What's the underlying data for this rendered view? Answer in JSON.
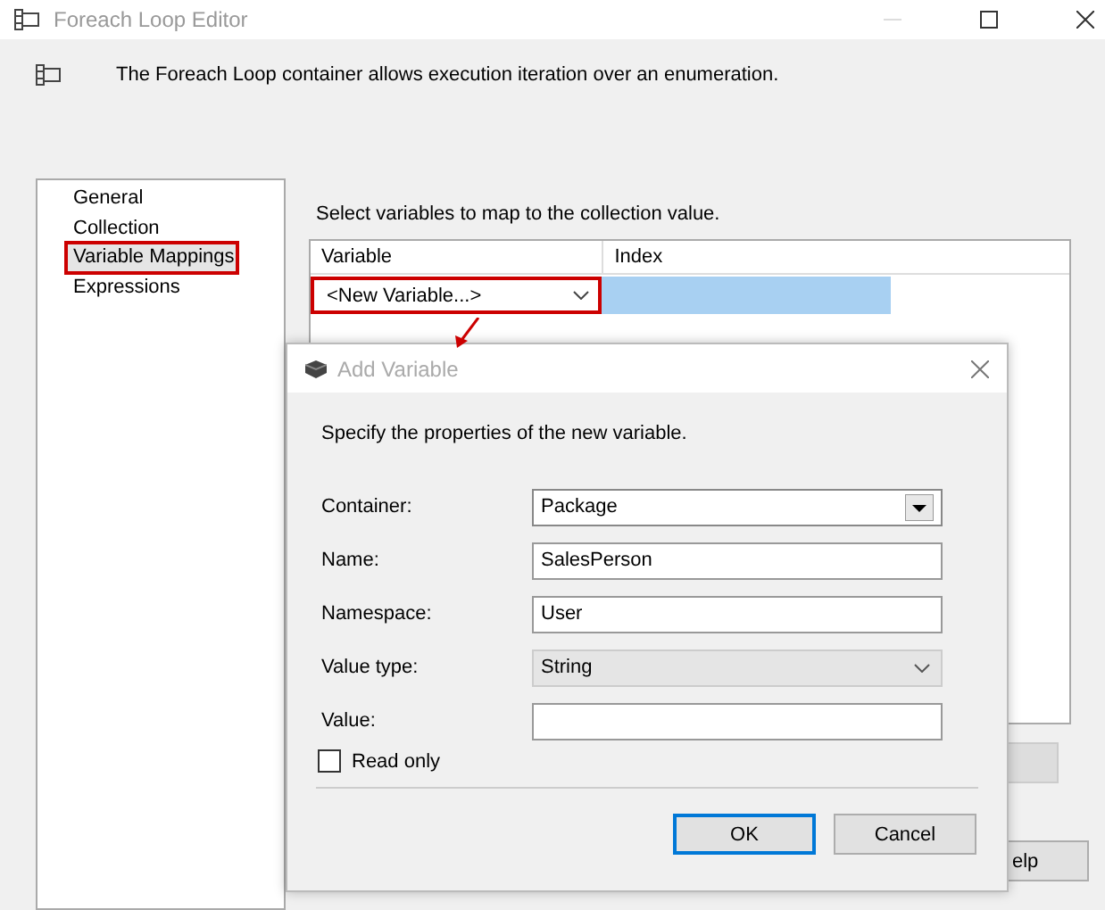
{
  "window": {
    "title": "Foreach Loop Editor"
  },
  "header": {
    "description": "The Foreach Loop container allows execution iteration over an enumeration."
  },
  "sidebar": {
    "items": [
      {
        "label": "General",
        "selected": false,
        "highlighted": false
      },
      {
        "label": "Collection",
        "selected": false,
        "highlighted": false
      },
      {
        "label": "Variable Mappings",
        "selected": true,
        "highlighted": true
      },
      {
        "label": "Expressions",
        "selected": false,
        "highlighted": false
      }
    ]
  },
  "mappings": {
    "instruction": "Select variables to map to the collection value.",
    "columns": [
      "Variable",
      "Index"
    ],
    "rows": [
      {
        "variable": "<New Variable...>",
        "highlighted": true
      }
    ]
  },
  "help_button": {
    "label": "elp"
  },
  "dialog": {
    "title": "Add Variable",
    "description": "Specify the properties of the new variable.",
    "fields": [
      {
        "kind": "combo",
        "label": "Container:",
        "value": "Package"
      },
      {
        "kind": "text",
        "label": "Name:",
        "value": "SalesPerson"
      },
      {
        "kind": "text",
        "label": "Namespace:",
        "value": "User"
      },
      {
        "kind": "select",
        "label": "Value type:",
        "value": "String"
      },
      {
        "kind": "text",
        "label": "Value:"
      }
    ],
    "read_only": {
      "label": "Read only",
      "checked": false
    },
    "buttons": [
      {
        "label": "OK",
        "default": true
      },
      {
        "label": "Cancel",
        "default": false
      }
    ]
  }
}
